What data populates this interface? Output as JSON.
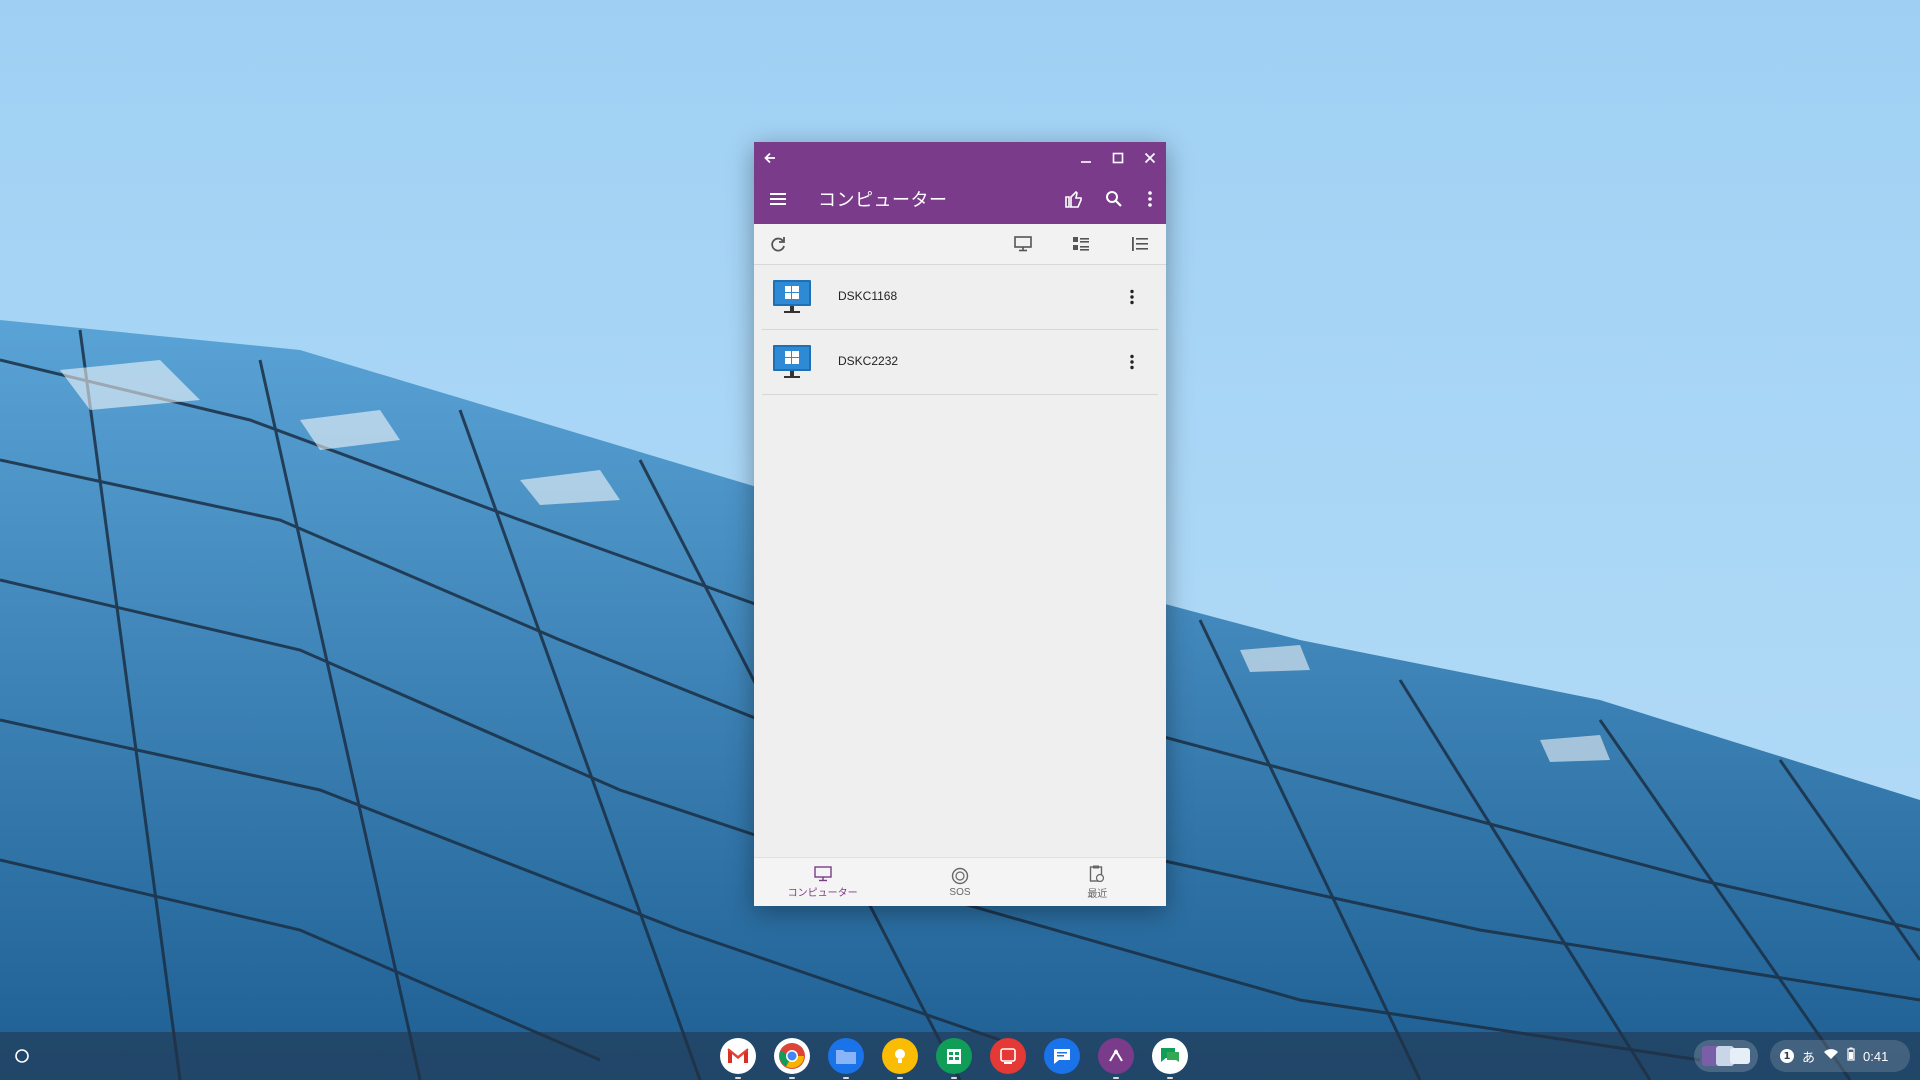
{
  "window": {
    "title": "コンピューター",
    "accent_color": "#7b3b8b"
  },
  "toolbar": {
    "icons": [
      "refresh-icon",
      "monitor-icon",
      "grid-list-icon",
      "sort-list-icon"
    ]
  },
  "computers": [
    {
      "name": "DSKC1168"
    },
    {
      "name": "DSKC2232"
    }
  ],
  "bottom_nav": [
    {
      "label": "コンピューター",
      "icon": "monitor-icon",
      "active": true
    },
    {
      "label": "SOS",
      "icon": "sos-icon",
      "active": false
    },
    {
      "label": "最近",
      "icon": "recent-icon",
      "active": false
    }
  ],
  "shelf": {
    "apps": [
      "gmail",
      "chrome",
      "files",
      "keep",
      "sheets",
      "legacy-app",
      "messages",
      "splashtop-business",
      "google-chat"
    ],
    "tray": {
      "notification_count": "1",
      "ime": "あ",
      "time": "0:41"
    }
  }
}
